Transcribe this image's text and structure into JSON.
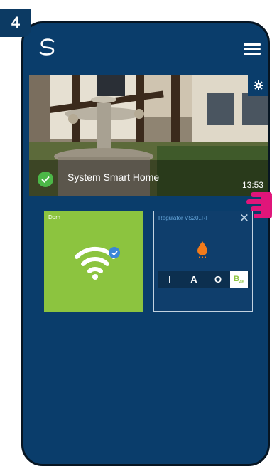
{
  "step": {
    "number": "4"
  },
  "header": {
    "logo_icon": "syxthsense-logo-icon",
    "menu_icon": "hamburger-menu-icon"
  },
  "home": {
    "name": "System Smart Home",
    "time": "13:53",
    "status": "connected",
    "status_icon": "check-circle-icon",
    "settings_icon": "gear-icon"
  },
  "tiles": [
    {
      "title": "Dom",
      "icon": "wifi-icon",
      "badge_icon": "check-icon",
      "color": "#8cc43f"
    },
    {
      "title": "Regulator VS20..RF",
      "close_label": "✕",
      "icon": "water-drop-icon",
      "modes": [
        "I",
        "A",
        "O"
      ],
      "active_mode": "B",
      "active_mode_sub": "4h"
    }
  ],
  "colors": {
    "app_bg": "#0a3d6b",
    "accent_green": "#8cc43f",
    "step_badge": "#0c3a63",
    "drop": "#f27a1a"
  },
  "pointer": {
    "icon": "hand-pointer-icon"
  }
}
